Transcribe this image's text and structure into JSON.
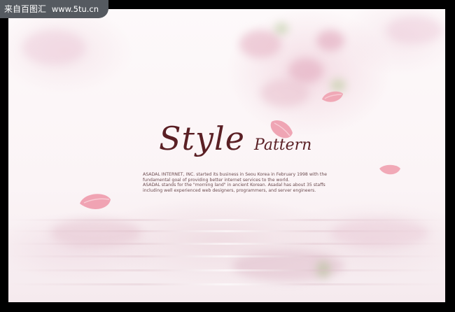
{
  "watermark": {
    "site_name": "来自百图汇",
    "url": "www.5tu.cn"
  },
  "artwork": {
    "title_main": "Style",
    "title_secondary": "Pattern",
    "body_lines": [
      "ASADAL INTERNET, INC. started its business in Seou Korea in February 1998 with the",
      "fundamental goal of providing better internet services to the world.",
      "ASADAL stands for the \"morning land\" in ancient Korean. Asadal has about 35 staffs",
      "including well experienced web designers, programmers, and server engineers."
    ]
  },
  "colors": {
    "title": "#5a1f24",
    "petal": "#f2a9b6",
    "frame": "#000000"
  }
}
